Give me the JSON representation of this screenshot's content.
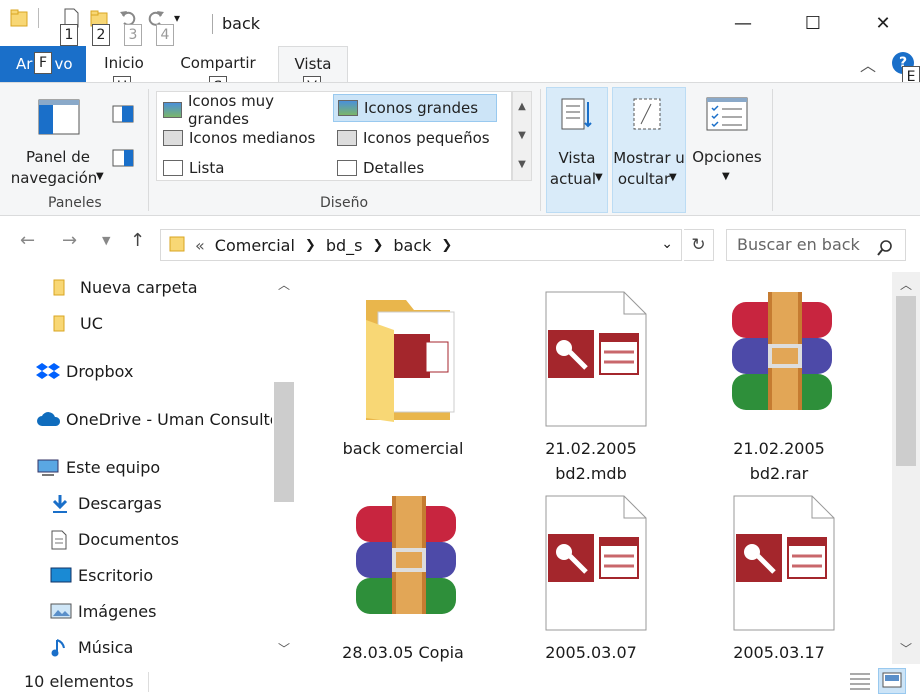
{
  "window": {
    "title": "back",
    "minimize": "—",
    "maximize": "☐",
    "close": "✕"
  },
  "qat": {
    "keytips": [
      "1",
      "2",
      "3",
      "4"
    ]
  },
  "ribbon_tabs": {
    "archivo_a": "Ar",
    "archivo_b": "vo",
    "archivo_keytip": "F",
    "inicio": "Inicio",
    "inicio_keytip": "H",
    "compartir": "Compartir",
    "compartir_keytip": "S",
    "vista": "Vista",
    "vista_keytip": "V",
    "help_keytip": "E",
    "help": "?"
  },
  "ribbon": {
    "paneles": {
      "group_label": "Paneles",
      "nav_pane_line1": "Panel de",
      "nav_pane_line2": "navegación"
    },
    "diseno": {
      "group_label": "Diseño",
      "items": [
        "Iconos muy grandes",
        "Iconos grandes",
        "Iconos medianos",
        "Iconos pequeños",
        "Lista",
        "Detalles"
      ],
      "selected": "Iconos grandes"
    },
    "vista_actual": {
      "line1": "Vista",
      "line2": "actual"
    },
    "mostrar": {
      "line1": "Mostrar u",
      "line2": "ocultar"
    },
    "opciones": {
      "label": "Opciones"
    }
  },
  "address": {
    "overflow": "«",
    "crumbs": [
      "Comercial",
      "bd_s",
      "back"
    ],
    "search_placeholder": "Buscar en back"
  },
  "sidebar": {
    "items": [
      {
        "label": "Nueva carpeta",
        "icon": "folder-icon"
      },
      {
        "label": "UC",
        "icon": "folder-icon"
      },
      {
        "label": "Dropbox",
        "icon": "dropbox-icon"
      },
      {
        "label": "OneDrive - Uman Consulto",
        "icon": "onedrive-icon"
      },
      {
        "label": "Este equipo",
        "icon": "computer-icon"
      },
      {
        "label": "Descargas",
        "icon": "download-icon"
      },
      {
        "label": "Documentos",
        "icon": "documents-icon"
      },
      {
        "label": "Escritorio",
        "icon": "desktop-icon"
      },
      {
        "label": "Imágenes",
        "icon": "pictures-icon"
      },
      {
        "label": "Música",
        "icon": "music-icon"
      }
    ]
  },
  "files": [
    {
      "line1": "back comercial",
      "line2": "",
      "type": "folder"
    },
    {
      "line1": "21.02.2005",
      "line2": "bd2.mdb",
      "type": "access"
    },
    {
      "line1": "21.02.2005",
      "line2": "bd2.rar",
      "type": "rar"
    },
    {
      "line1": "28.03.05 Copia",
      "line2": "",
      "type": "rar"
    },
    {
      "line1": "2005.03.07",
      "line2": "",
      "type": "access"
    },
    {
      "line1": "2005.03.17",
      "line2": "",
      "type": "access"
    }
  ],
  "status": {
    "count": "10 elementos"
  },
  "colors": {
    "accent": "#1a6fc9",
    "selection": "#cce4f7",
    "access_red": "#a4262c",
    "folder_yellow": "#f8d775"
  }
}
